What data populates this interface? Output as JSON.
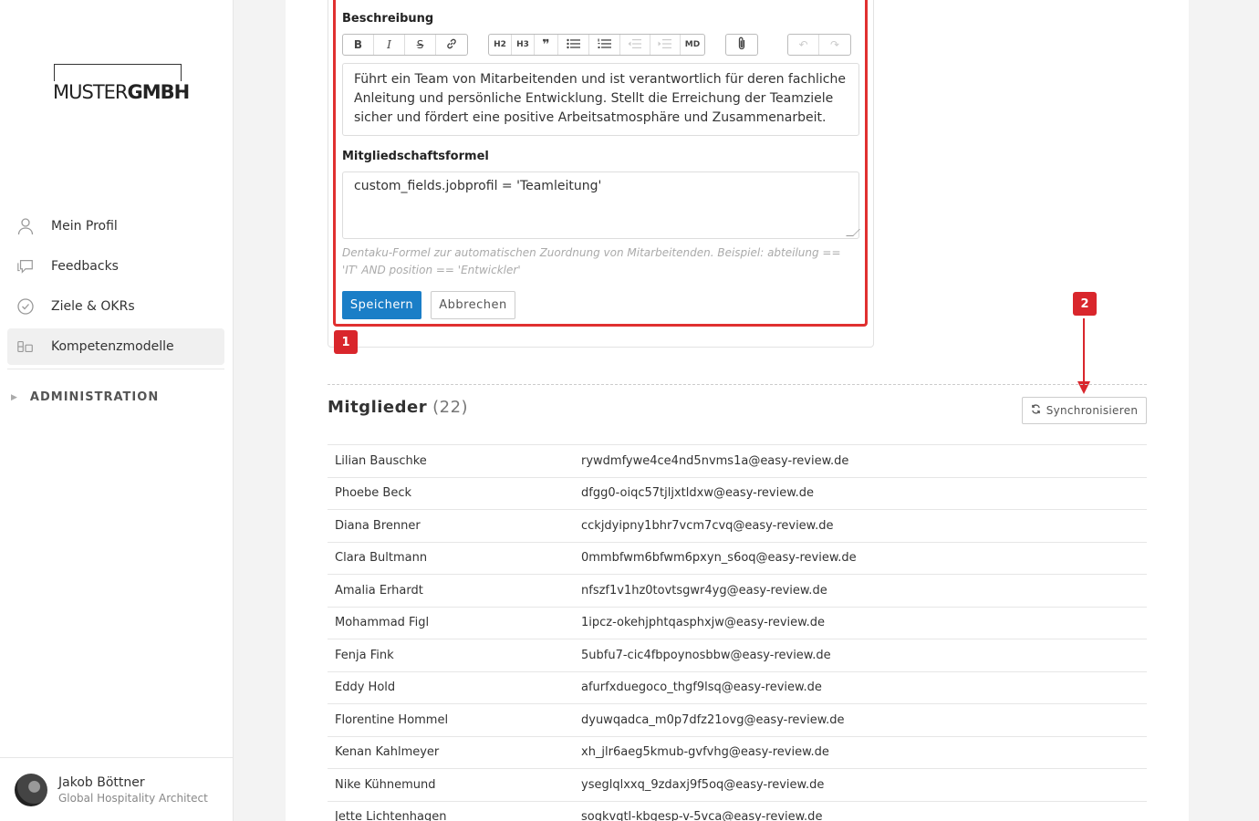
{
  "brand": {
    "light": "MUSTER",
    "bold": "GMBH"
  },
  "nav": {
    "items": [
      {
        "label": "Mein Profil",
        "icon": "user-icon"
      },
      {
        "label": "Feedbacks",
        "icon": "chat-icon"
      },
      {
        "label": "Ziele & OKRs",
        "icon": "check-circle-icon"
      },
      {
        "label": "Kompetenzmodelle",
        "icon": "model-icon"
      }
    ],
    "admin_label": "ADMINISTRATION"
  },
  "user": {
    "name": "Jakob Böttner",
    "role": "Global Hospitality Architect"
  },
  "form": {
    "description_label": "Beschreibung",
    "toolbar": {
      "bold": "B",
      "italic": "I",
      "strike": "S",
      "link": "🔗",
      "h2": "H2",
      "h3": "H3",
      "quote": "❞",
      "ul": "≡",
      "ol": "≡",
      "outdent": "⇤",
      "indent": "⇥",
      "md": "MD",
      "attach": "📎",
      "undo": "↶",
      "redo": "↷"
    },
    "description_text": "Führt ein Team von Mitarbeitenden und ist verantwortlich für deren fachliche Anleitung und persönliche Entwicklung. Stellt die Erreichung der Teamziele sicher und fördert eine positive Arbeitsatmosphäre und Zusammenarbeit.",
    "formula_label": "Mitgliedschaftsformel",
    "formula_value": "custom_fields.jobprofil = 'Teamleitung'",
    "formula_hint": "Dentaku-Formel zur automatischen Zuordnung von Mitarbeitenden. Beispiel: abteilung == 'IT' AND position == 'Entwickler'",
    "save_label": "Speichern",
    "cancel_label": "Abbrechen"
  },
  "annotations": {
    "badge1": "1",
    "badge2": "2",
    "color": "#d9262c"
  },
  "members": {
    "title": "Mitglieder",
    "count": "(22)",
    "sync_label": "Synchronisieren",
    "rows": [
      {
        "name": "Lilian Bauschke",
        "email": "rywdmfywe4ce4nd5nvms1a@easy-review.de"
      },
      {
        "name": "Phoebe Beck",
        "email": "dfgg0-oiqc57tjljxtldxw@easy-review.de"
      },
      {
        "name": "Diana Brenner",
        "email": "cckjdyipny1bhr7vcm7cvq@easy-review.de"
      },
      {
        "name": "Clara Bultmann",
        "email": "0mmbfwm6bfwm6pxyn_s6oq@easy-review.de"
      },
      {
        "name": "Amalia Erhardt",
        "email": "nfszf1v1hz0tovtsgwr4yg@easy-review.de"
      },
      {
        "name": "Mohammad Figl",
        "email": "1ipcz-okehjphtqasphxjw@easy-review.de"
      },
      {
        "name": "Fenja Fink",
        "email": "5ubfu7-cic4fbpoynosbbw@easy-review.de"
      },
      {
        "name": "Eddy Hold",
        "email": "afurfxduegoco_thgf9lsq@easy-review.de"
      },
      {
        "name": "Florentine Hommel",
        "email": "dyuwqadca_m0p7dfz21ovg@easy-review.de"
      },
      {
        "name": "Kenan Kahlmeyer",
        "email": "xh_jlr6aeg5kmub-gvfvhg@easy-review.de"
      },
      {
        "name": "Nike Kühnemund",
        "email": "yseglqlxxq_9zdaxj9f5oq@easy-review.de"
      },
      {
        "name": "Jette Lichtenhagen",
        "email": "sogkvqtl-kbgesp-v-5vca@easy-review.de"
      }
    ]
  }
}
